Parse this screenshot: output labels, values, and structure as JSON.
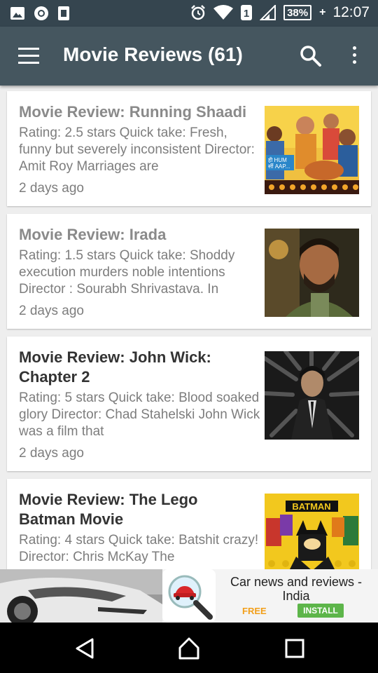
{
  "status_bar": {
    "left_icons": [
      "gallery-icon",
      "chrome-icon",
      "sim-app-icon"
    ],
    "right_icons": [
      "alarm-icon",
      "wifi-icon",
      "sim-1-icon",
      "signal-icon"
    ],
    "sim_number": "1",
    "battery_percent": "38%",
    "battery_charging": "+",
    "time": "12:07"
  },
  "app_bar": {
    "title": "Movie Reviews (61)",
    "menu_icon": "hamburger-menu-icon",
    "search_icon": "search-icon",
    "more_icon": "more-vert-icon",
    "background": "#45565f"
  },
  "reviews": [
    {
      "title": "Movie Review: Running Shaadi",
      "excerpt": "Rating: 2.5 stars Quick take: Fresh, funny but severely inconsistent Director: Amit Roy Marriages are",
      "time": "2 days ago",
      "read": true,
      "thumb_caption": "ही HUM\nर्सी AAP..."
    },
    {
      "title": "Movie Review: Irada",
      "excerpt": "Rating: 1.5 stars Quick take: Shoddy execution murders noble intentions Director : Sourabh Shrivastava. In",
      "time": "2 days ago",
      "read": true
    },
    {
      "title": "Movie Review: John Wick: Chapter 2",
      "excerpt": "Rating: 5 stars Quick take: Blood soaked glory Director: Chad Stahelski John Wick was a film that",
      "time": "2 days ago",
      "read": false
    },
    {
      "title": "Movie Review: The Lego Batman Movie",
      "excerpt": "Rating: 4 stars  Quick take: Batshit crazy!  Director: Chris McKay The",
      "time": "",
      "read": false,
      "thumb_caption": "BATMAN"
    }
  ],
  "ad": {
    "title": "Car news and reviews - India",
    "free_label": "FREE",
    "install_label": "INSTALL",
    "icon": "car-magnifier-icon"
  },
  "nav_bar": {
    "back_icon": "back-triangle-icon",
    "home_icon": "home-icon",
    "recents_icon": "recents-square-icon"
  }
}
